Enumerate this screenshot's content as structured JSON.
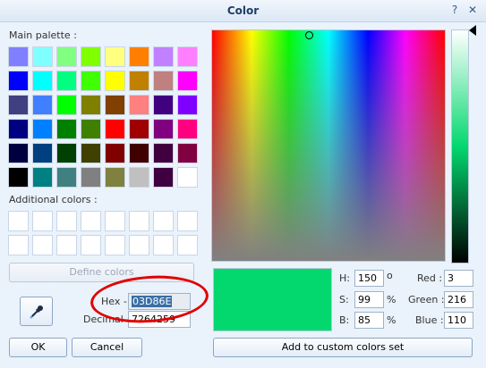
{
  "window": {
    "title": "Color",
    "help_glyph": "?",
    "close_glyph": "✕"
  },
  "palette": {
    "main_label": "Main palette :",
    "main_colors": [
      "#8080ff",
      "#80ffff",
      "#80ff80",
      "#80ff00",
      "#ffff80",
      "#ff8000",
      "#c080ff",
      "#ff80ff",
      "#0000ff",
      "#00ffff",
      "#00ff80",
      "#40ff00",
      "#ffff00",
      "#c08000",
      "#c08080",
      "#ff00ff",
      "#404080",
      "#4080ff",
      "#00ff00",
      "#808000",
      "#804000",
      "#ff8080",
      "#400080",
      "#8000ff",
      "#000080",
      "#0080ff",
      "#008000",
      "#408000",
      "#ff0000",
      "#a00000",
      "#800080",
      "#ff0080",
      "#000040",
      "#004080",
      "#004000",
      "#404000",
      "#800000",
      "#400000",
      "#400040",
      "#800040",
      "#000000",
      "#008080",
      "#408080",
      "#808080",
      "#808040",
      "#c0c0c0",
      "#400040",
      "#ffffff"
    ],
    "additional_label": "Additional colors :",
    "additional_colors": [
      "#ffffff",
      "#ffffff",
      "#ffffff",
      "#ffffff",
      "#ffffff",
      "#ffffff",
      "#ffffff",
      "#ffffff",
      "#ffffff",
      "#ffffff",
      "#ffffff",
      "#ffffff",
      "#ffffff",
      "#ffffff",
      "#ffffff",
      "#ffffff"
    ]
  },
  "buttons": {
    "define_colors": "Define colors",
    "ok": "OK",
    "cancel": "Cancel",
    "add_custom": "Add to custom colors set"
  },
  "fields": {
    "hex_label": "Hex -",
    "hex_value": "03D86E",
    "decimal_label": "Decimal -",
    "decimal_value": "7264259",
    "h_label": "H:",
    "h_value": "150",
    "h_unit": "o",
    "s_label": "S:",
    "s_value": "99",
    "s_unit": "%",
    "b_label": "B:",
    "b_value": "85",
    "b_unit": "%",
    "red_label": "Red :",
    "red_value": "3",
    "green_label": "Green :",
    "green_value": "216",
    "blue_label": "Blue :",
    "blue_value": "110"
  },
  "colors": {
    "current": "#03d86e",
    "annotation": "#e00000"
  },
  "icons": {
    "eyedropper": "eyedropper-icon"
  }
}
